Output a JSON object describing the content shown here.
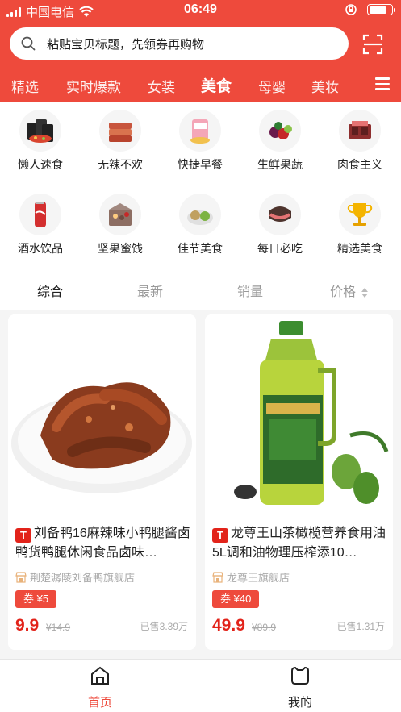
{
  "status": {
    "carrier": "中国电信",
    "time": "06:49"
  },
  "search": {
    "placeholder": "粘贴宝贝标题，先领券再购物"
  },
  "tabs": [
    {
      "label": "精选"
    },
    {
      "label": "实时爆款"
    },
    {
      "label": "女装"
    },
    {
      "label": "美食",
      "active": true
    },
    {
      "label": "母婴"
    },
    {
      "label": "美妆"
    }
  ],
  "categories": [
    {
      "label": "懒人速食",
      "icon": "instant-noodle-icon"
    },
    {
      "label": "无辣不欢",
      "icon": "spicy-snack-icon"
    },
    {
      "label": "快捷早餐",
      "icon": "breakfast-bread-icon"
    },
    {
      "label": "生鲜果蔬",
      "icon": "fruit-icon"
    },
    {
      "label": "肉食主义",
      "icon": "meat-box-icon"
    },
    {
      "label": "酒水饮品",
      "icon": "cola-can-icon"
    },
    {
      "label": "坚果蜜饯",
      "icon": "nuts-box-icon"
    },
    {
      "label": "佳节美食",
      "icon": "festival-dish-icon"
    },
    {
      "label": "每日必吃",
      "icon": "daily-food-icon"
    },
    {
      "label": "精选美食",
      "icon": "trophy-icon"
    }
  ],
  "sort": {
    "comprehensive": "综合",
    "newest": "最新",
    "sales": "销量",
    "price": "价格"
  },
  "products": [
    {
      "badge": "T",
      "title": "刘备鸭16麻辣味小鸭腿酱卤鸭货鸭腿休闲食品卤味…",
      "shop": "荆楚潺陵刘备鸭旗舰店",
      "coupon": "券 ¥5",
      "price": "9.9",
      "original_price": "¥14.9",
      "sold": "已售3.39万"
    },
    {
      "badge": "T",
      "title": "龙尊王山茶橄榄营养食用油5L调和油物理压榨添10…",
      "shop": "龙尊王旗舰店",
      "coupon": "券 ¥40",
      "price": "49.9",
      "original_price": "¥89.9",
      "sold": "已售1.31万"
    }
  ],
  "bottom_nav": {
    "home": "首页",
    "mine": "我的"
  },
  "colors": {
    "brand_red": "#ee4a3c",
    "price_red": "#e2231a"
  }
}
